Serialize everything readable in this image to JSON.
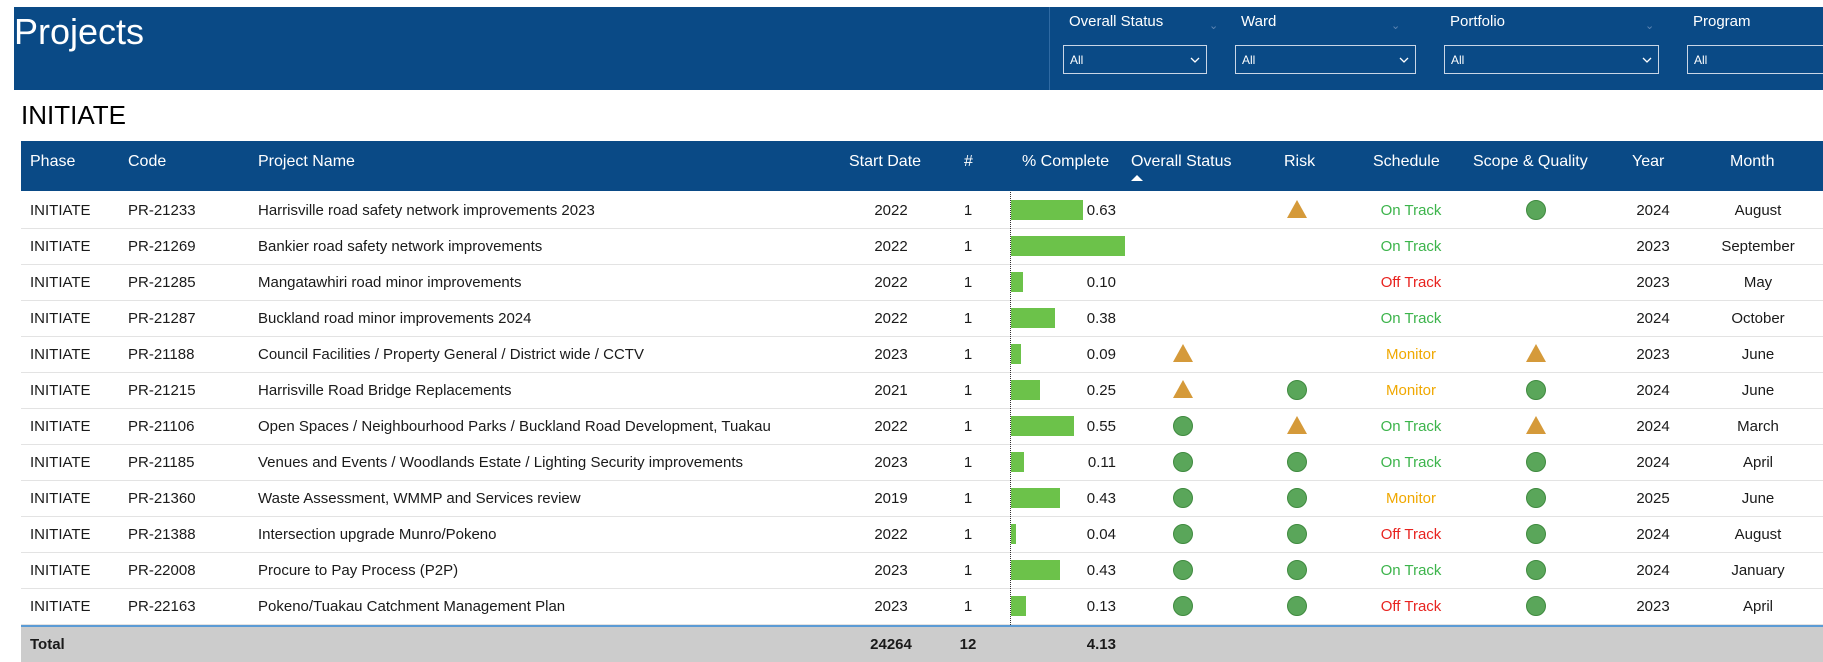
{
  "header": {
    "title": "Projects",
    "filters": [
      {
        "label": "Overall Status",
        "value": "All"
      },
      {
        "label": "Ward",
        "value": "All"
      },
      {
        "label": "Portfolio",
        "value": "All"
      },
      {
        "label": "Program",
        "value": "All"
      }
    ]
  },
  "section_title": "INITIATE",
  "columns": [
    "Phase",
    "Code",
    "Project Name",
    "Start Date",
    "#",
    "% Complete",
    "Overall Status",
    "Risk",
    "Schedule",
    "Scope & Quality",
    "Year",
    "Month"
  ],
  "colors": {
    "header_bg": "#0a4a86",
    "bar": "#6cc24a",
    "green": "#5aa65a",
    "amber": "#d59a3a",
    "on_track": "#3cb44b",
    "off_track": "#e8231f",
    "monitor": "#f0a800"
  },
  "rows": [
    {
      "phase": "INITIATE",
      "code": "PR-21233",
      "name": "Harrisville road safety network improvements 2023",
      "start": "2022",
      "count": "1",
      "pct": "0.63",
      "pct_value": 0.63,
      "overall": "",
      "risk": "triangle",
      "schedule": "On Track",
      "scope": "circle",
      "year": "2024",
      "month": "August"
    },
    {
      "phase": "INITIATE",
      "code": "PR-21269",
      "name": "Bankier road safety network improvements",
      "start": "2022",
      "count": "1",
      "pct": "0.99",
      "pct_value": 0.99,
      "overall": "",
      "risk": "",
      "schedule": "On Track",
      "scope": "",
      "year": "2023",
      "month": "September"
    },
    {
      "phase": "INITIATE",
      "code": "PR-21285",
      "name": "Mangatawhiri road minor improvements",
      "start": "2022",
      "count": "1",
      "pct": "0.10",
      "pct_value": 0.1,
      "overall": "",
      "risk": "",
      "schedule": "Off Track",
      "scope": "",
      "year": "2023",
      "month": "May"
    },
    {
      "phase": "INITIATE",
      "code": "PR-21287",
      "name": "Buckland road minor improvements 2024",
      "start": "2022",
      "count": "1",
      "pct": "0.38",
      "pct_value": 0.38,
      "overall": "",
      "risk": "",
      "schedule": "On Track",
      "scope": "",
      "year": "2024",
      "month": "October"
    },
    {
      "phase": "INITIATE",
      "code": "PR-21188",
      "name": "Council Facilities / Property General / District wide / CCTV",
      "start": "2023",
      "count": "1",
      "pct": "0.09",
      "pct_value": 0.09,
      "overall": "triangle",
      "risk": "",
      "schedule": "Monitor",
      "scope": "triangle",
      "year": "2023",
      "month": "June"
    },
    {
      "phase": "INITIATE",
      "code": "PR-21215",
      "name": "Harrisville Road Bridge Replacements",
      "start": "2021",
      "count": "1",
      "pct": "0.25",
      "pct_value": 0.25,
      "overall": "triangle",
      "risk": "circle",
      "schedule": "Monitor",
      "scope": "circle",
      "year": "2024",
      "month": "June"
    },
    {
      "phase": "INITIATE",
      "code": "PR-21106",
      "name": "Open Spaces / Neighbourhood Parks / Buckland Road Development, Tuakau",
      "start": "2022",
      "count": "1",
      "pct": "0.55",
      "pct_value": 0.55,
      "overall": "circle",
      "risk": "triangle",
      "schedule": "On Track",
      "scope": "triangle",
      "year": "2024",
      "month": "March"
    },
    {
      "phase": "INITIATE",
      "code": "PR-21185",
      "name": "Venues and Events / Woodlands Estate / Lighting Security improvements",
      "start": "2023",
      "count": "1",
      "pct": "0.11",
      "pct_value": 0.11,
      "overall": "circle",
      "risk": "circle",
      "schedule": "On Track",
      "scope": "circle",
      "year": "2024",
      "month": "April"
    },
    {
      "phase": "INITIATE",
      "code": "PR-21360",
      "name": "Waste Assessment, WMMP and Services review",
      "start": "2019",
      "count": "1",
      "pct": "0.43",
      "pct_value": 0.43,
      "overall": "circle",
      "risk": "circle",
      "schedule": "Monitor",
      "scope": "circle",
      "year": "2025",
      "month": "June"
    },
    {
      "phase": "INITIATE",
      "code": "PR-21388",
      "name": "Intersection upgrade Munro/Pokeno",
      "start": "2022",
      "count": "1",
      "pct": "0.04",
      "pct_value": 0.04,
      "overall": "circle",
      "risk": "circle",
      "schedule": "Off Track",
      "scope": "circle",
      "year": "2024",
      "month": "August"
    },
    {
      "phase": "INITIATE",
      "code": "PR-22008",
      "name": "Procure to Pay Process (P2P)",
      "start": "2023",
      "count": "1",
      "pct": "0.43",
      "pct_value": 0.43,
      "overall": "circle",
      "risk": "circle",
      "schedule": "On Track",
      "scope": "circle",
      "year": "2024",
      "month": "January"
    },
    {
      "phase": "INITIATE",
      "code": "PR-22163",
      "name": "Pokeno/Tuakau Catchment Management Plan",
      "start": "2023",
      "count": "1",
      "pct": "0.13",
      "pct_value": 0.13,
      "overall": "circle",
      "risk": "circle",
      "schedule": "Off Track",
      "scope": "circle",
      "year": "2023",
      "month": "April"
    }
  ],
  "total": {
    "label": "Total",
    "start": "24264",
    "count": "12",
    "pct": "4.13"
  }
}
